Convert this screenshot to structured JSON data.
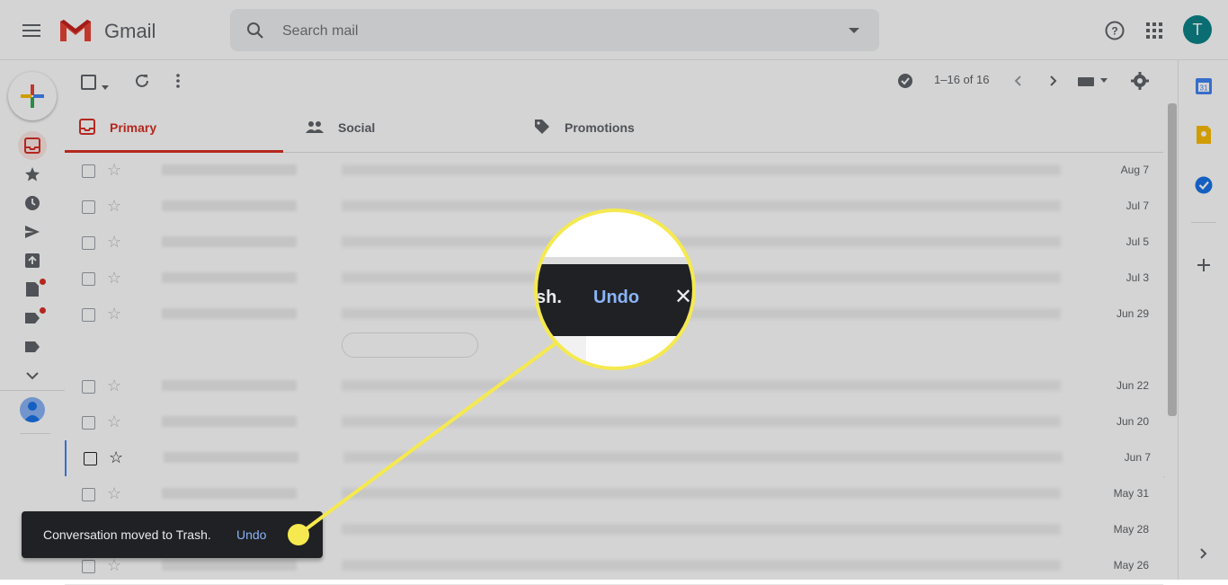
{
  "app": {
    "name": "Gmail",
    "user_initial": "T"
  },
  "search": {
    "placeholder": "Search mail"
  },
  "toolbar": {
    "pager": "1–16 of 16"
  },
  "tabs": [
    {
      "label": "Primary",
      "icon": "inbox-icon",
      "active": true
    },
    {
      "label": "Social",
      "icon": "people-icon",
      "active": false
    },
    {
      "label": "Promotions",
      "icon": "tag-icon",
      "active": false
    }
  ],
  "emails": [
    {
      "date": "Aug 7"
    },
    {
      "date": "Jul 7"
    },
    {
      "date": "Jul 5"
    },
    {
      "date": "Jul 3"
    },
    {
      "date": "Jun 29"
    },
    {
      "date": "Jun 22"
    },
    {
      "date": "Jun 20"
    },
    {
      "date": "Jun 7"
    },
    {
      "date": "May 31"
    },
    {
      "date": "May 28"
    },
    {
      "date": "May 26"
    }
  ],
  "snackbar": {
    "message": "Conversation moved to Trash.",
    "action": "Undo"
  },
  "zoom": {
    "partial_text": "sh.",
    "action": "Undo",
    "close_glyph": "✕"
  },
  "colors": {
    "gmail_red": "#d93025",
    "accent_yellow": "#f5e94f",
    "avatar_teal": "#0b8489",
    "snackbar_bg": "#202124",
    "link_blue": "#8ab4f8"
  }
}
